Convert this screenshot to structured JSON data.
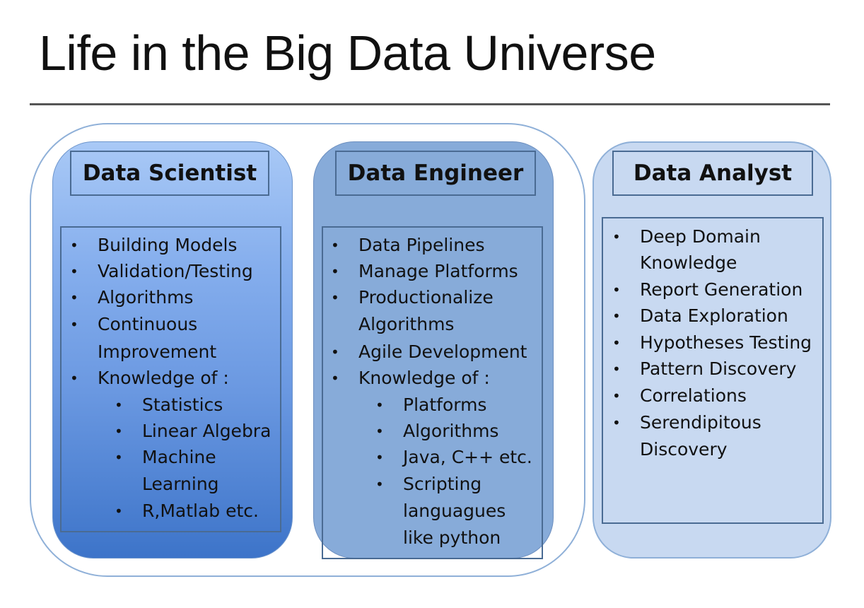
{
  "title": "Life in the Big Data Universe",
  "roles": [
    {
      "name": "Data Scientist",
      "items": [
        "Building Models",
        "Validation/Testing",
        "Algorithms",
        "Continuous",
        "Improvement",
        "Knowledge of :",
        "Statistics",
        "Linear Algebra",
        "Machine",
        "Learning",
        "R,Matlab etc."
      ]
    },
    {
      "name": "Data Engineer",
      "items": [
        "Data Pipelines",
        "Manage Platforms",
        "Productionalize",
        "Algorithms",
        "Agile Development",
        "Knowledge of :",
        "Platforms",
        "Algorithms",
        "Java, C++ etc.",
        "Scripting",
        "languagues",
        "like python"
      ]
    },
    {
      "name": "Data Analyst",
      "items": [
        "Deep Domain",
        "Knowledge",
        "Report Generation",
        "Data Exploration",
        "Hypotheses Testing",
        "Pattern Discovery",
        "Correlations",
        "Serendipitous",
        "Discovery"
      ]
    }
  ],
  "bullet_char": "•"
}
